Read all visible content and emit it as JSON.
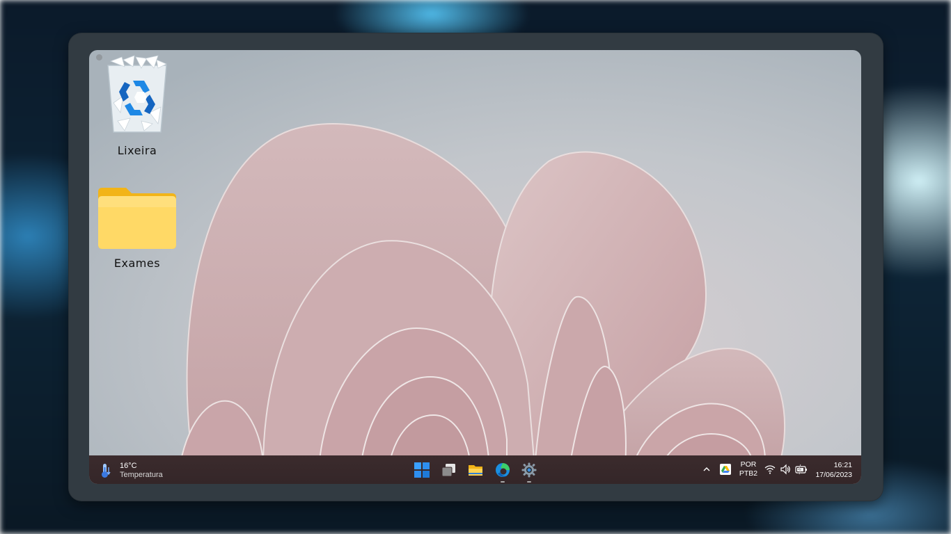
{
  "desktop": {
    "icons": [
      {
        "label": "Lixeira",
        "icon": "recycle-bin-icon"
      },
      {
        "label": "Exames",
        "icon": "folder-icon"
      }
    ]
  },
  "taskbar": {
    "weather": {
      "temperature": "16°C",
      "description": "Temperatura",
      "icon": "thermometer-icon"
    },
    "apps": [
      {
        "name": "start",
        "icon": "windows-start-icon"
      },
      {
        "name": "task-view",
        "icon": "task-view-icon"
      },
      {
        "name": "file-explorer",
        "icon": "file-explorer-icon"
      },
      {
        "name": "edge",
        "icon": "edge-browser-icon"
      },
      {
        "name": "settings",
        "icon": "settings-gear-icon"
      }
    ],
    "tray": {
      "language_line1": "POR",
      "language_line2": "PTB2",
      "time": "16:21",
      "date": "17/06/2023"
    }
  },
  "colors": {
    "taskbar": "#3a2a2c",
    "device_frame": "#323b42",
    "accent_blue": "#0078d4",
    "folder_yellow": "#ffc83d"
  }
}
